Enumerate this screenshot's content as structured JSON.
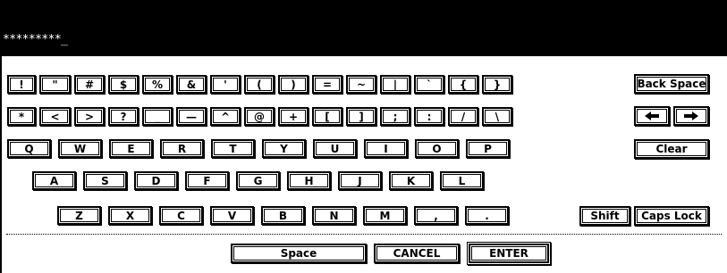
{
  "input": {
    "value": "*********",
    "cursor": "_"
  },
  "keys": {
    "exclaim": "!",
    "dquote": "\"",
    "hash": "#",
    "dollar": "$",
    "percent": "%",
    "amp": "&",
    "apos": "'",
    "lparen": "(",
    "rparen": ")",
    "equals": "=",
    "tilde": "~",
    "pipe": "|",
    "backtick": "`",
    "lbrace": "{",
    "rbrace": "}",
    "backspace": "Back Space",
    "asterisk": "*",
    "lt": "<",
    "gt": ">",
    "question": "?",
    "underscore": "_",
    "dash": "—",
    "caret": "^",
    "at": "@",
    "plus": "+",
    "lbracket": "[",
    "rbracket": "]",
    "semicolon": ";",
    "colon": ":",
    "slash": "/",
    "backslash": "\\",
    "q": "Q",
    "w": "W",
    "e": "E",
    "r": "R",
    "t": "T",
    "y": "Y",
    "u": "U",
    "i": "I",
    "o": "O",
    "p": "P",
    "clear": "Clear",
    "a": "A",
    "s": "S",
    "d": "D",
    "f": "F",
    "g": "G",
    "h": "H",
    "j": "J",
    "k": "K",
    "l": "L",
    "z": "Z",
    "x": "X",
    "c": "C",
    "v": "V",
    "b": "B",
    "n": "N",
    "m": "M",
    "comma": ",",
    "period": ".",
    "shift": "Shift",
    "capslock": "Caps Lock",
    "space": "Space",
    "cancel": "CANCEL",
    "enter": "ENTER",
    "arrow_left_icon": "arrow-left-icon",
    "arrow_right_icon": "arrow-right-icon"
  }
}
